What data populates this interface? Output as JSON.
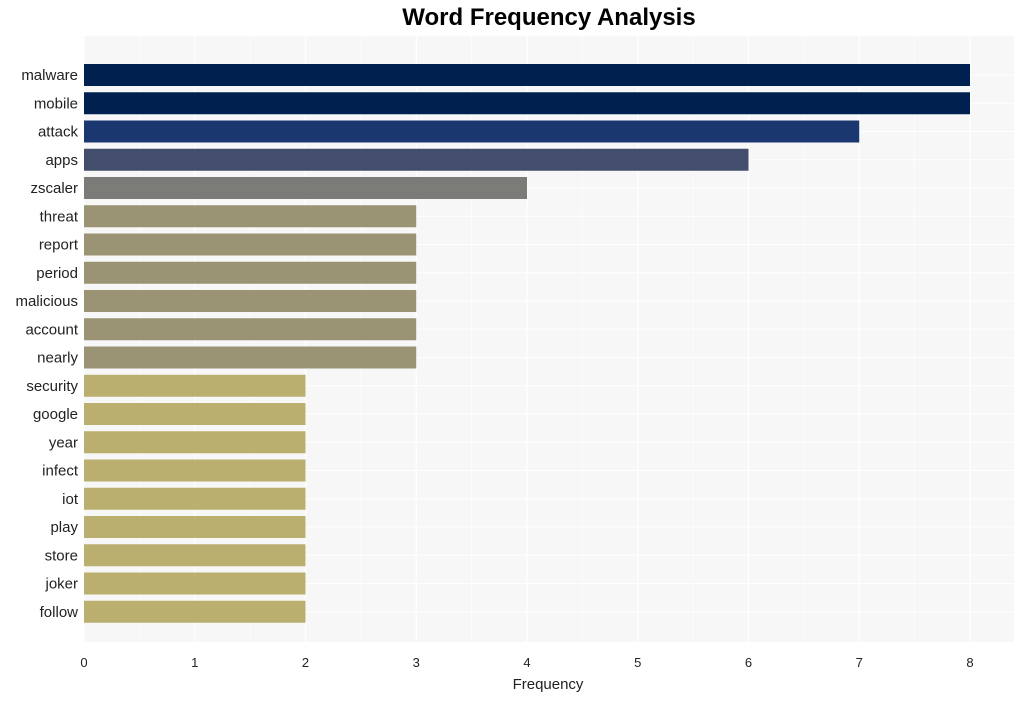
{
  "chart_data": {
    "type": "bar",
    "orientation": "horizontal",
    "title": "Word Frequency Analysis",
    "xlabel": "Frequency",
    "ylabel": "",
    "xlim": [
      0,
      8.4
    ],
    "xticks": [
      0,
      1,
      2,
      3,
      4,
      5,
      6,
      7,
      8
    ],
    "grid": true,
    "legend": "none",
    "categories": [
      "malware",
      "mobile",
      "attack",
      "apps",
      "zscaler",
      "threat",
      "report",
      "period",
      "malicious",
      "account",
      "nearly",
      "security",
      "google",
      "year",
      "infect",
      "iot",
      "play",
      "store",
      "joker",
      "follow"
    ],
    "values": [
      8,
      8,
      7,
      6,
      4,
      3,
      3,
      3,
      3,
      3,
      3,
      2,
      2,
      2,
      2,
      2,
      2,
      2,
      2,
      2
    ],
    "colors": [
      "#00204f",
      "#00204f",
      "#1a3770",
      "#434e6c",
      "#7b7b77",
      "#9b9474",
      "#9b9474",
      "#9b9474",
      "#9b9474",
      "#9b9474",
      "#9b9474",
      "#baaf6e",
      "#baaf6e",
      "#baaf6e",
      "#baaf6e",
      "#baaf6e",
      "#baaf6e",
      "#baaf6e",
      "#baaf6e",
      "#baaf6e"
    ]
  }
}
